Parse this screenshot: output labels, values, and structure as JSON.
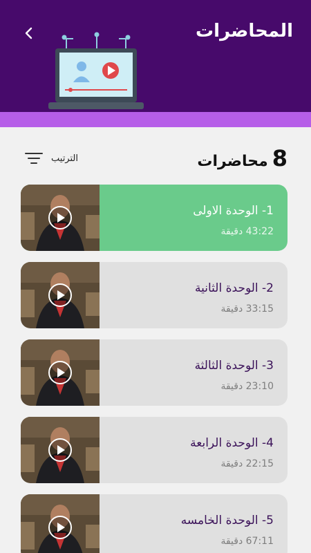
{
  "header": {
    "title": "المحاضرات"
  },
  "summary": {
    "count": "8",
    "label": "محاضرات"
  },
  "sort": {
    "label": "الترتيب"
  },
  "lectures": [
    {
      "title": "1- الوحدة الاولى",
      "duration": "43:22 دقيقة",
      "active": true
    },
    {
      "title": "2-  الوحدة الثانية",
      "duration": "33:15 دقيقة",
      "active": false
    },
    {
      "title": "3- الوحدة الثالثة",
      "duration": "23:10 دقيقة",
      "active": false
    },
    {
      "title": "4- الوحدة الرابعة",
      "duration": "22:15 دقيقة",
      "active": false
    },
    {
      "title": "5- الوحدة الخامسه",
      "duration": "67:11 دقيقة",
      "active": false
    }
  ],
  "colors": {
    "header": "#470a6b",
    "stripe": "#b65ee8",
    "active_card": "#6acb8b",
    "card": "#e0e0e0",
    "title_text": "#3b1259"
  }
}
